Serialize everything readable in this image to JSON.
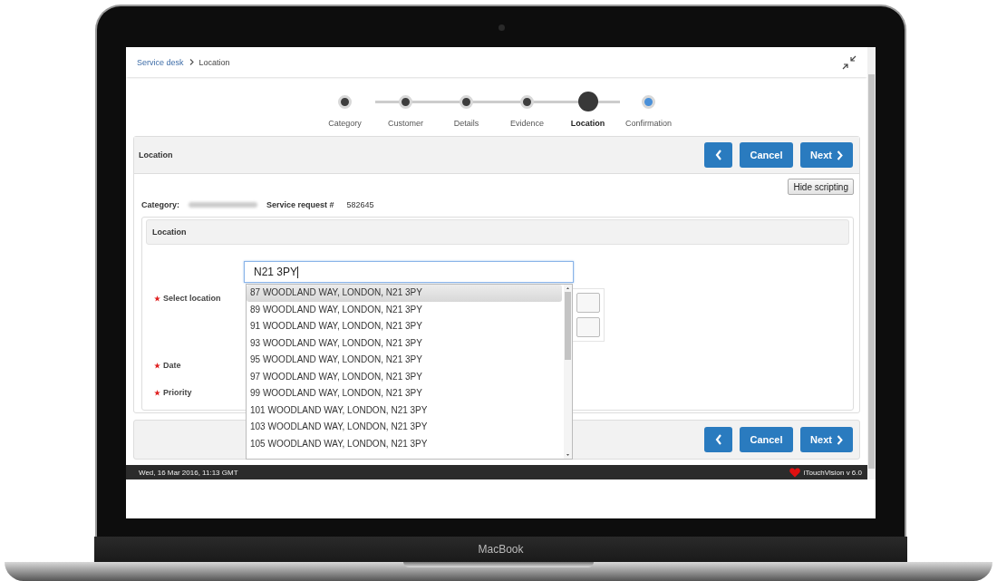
{
  "device": {
    "brand_label": "MacBook"
  },
  "breadcrumb": [
    {
      "label": "Service desk",
      "kind": "link"
    },
    {
      "label": "Location",
      "kind": "current"
    }
  ],
  "stepper": [
    {
      "label": "Category",
      "completed": true,
      "selected": false
    },
    {
      "label": "Customer",
      "completed": true,
      "selected": false
    },
    {
      "label": "Details",
      "completed": true,
      "selected": false
    },
    {
      "label": "Evidence",
      "completed": true,
      "selected": false
    },
    {
      "label": "Location",
      "completed": false,
      "selected": true
    },
    {
      "label": "Confirmation",
      "completed": false,
      "selected": false
    }
  ],
  "panel": {
    "title": "Location",
    "hide_scripting": "Hide scripting",
    "category_label": "Category:",
    "request_label": "Service request #",
    "request_number": "582645"
  },
  "header_buttons": [
    {
      "kind": "back"
    },
    {
      "kind": "cancel",
      "label": "Cancel"
    },
    {
      "kind": "next",
      "label": "Next"
    }
  ],
  "footer_buttons": [
    {
      "kind": "back"
    },
    {
      "kind": "cancel",
      "label": "Cancel"
    },
    {
      "kind": "next",
      "label": "Next"
    }
  ],
  "section": {
    "title": "Location",
    "fields": [
      {
        "label": "Select location",
        "required": true,
        "kind": "location"
      },
      {
        "label": "Date",
        "required": true,
        "kind": "plain"
      },
      {
        "label": "Priority",
        "required": true,
        "kind": "plain"
      }
    ]
  },
  "location_search": {
    "value": "N21 3PY",
    "suggestions": [
      {
        "label": "87 WOODLAND WAY, LONDON, N21 3PY",
        "selected": true
      },
      {
        "label": "89 WOODLAND WAY, LONDON, N21 3PY",
        "selected": false
      },
      {
        "label": "91 WOODLAND WAY, LONDON, N21 3PY",
        "selected": false
      },
      {
        "label": "93 WOODLAND WAY, LONDON, N21 3PY",
        "selected": false
      },
      {
        "label": "95 WOODLAND WAY, LONDON, N21 3PY",
        "selected": false
      },
      {
        "label": "97 WOODLAND WAY, LONDON, N21 3PY",
        "selected": false
      },
      {
        "label": "99 WOODLAND WAY, LONDON, N21 3PY",
        "selected": false
      },
      {
        "label": "101 WOODLAND WAY, LONDON, N21 3PY",
        "selected": false
      },
      {
        "label": "103 WOODLAND WAY, LONDON, N21 3PY",
        "selected": false
      },
      {
        "label": "105 WOODLAND WAY, LONDON, N21 3PY",
        "selected": false
      }
    ]
  },
  "status_bar": {
    "date": "Wed, 16 Mar 2016, 11:13 GMT",
    "version": "iTouchVision v 6.0"
  }
}
